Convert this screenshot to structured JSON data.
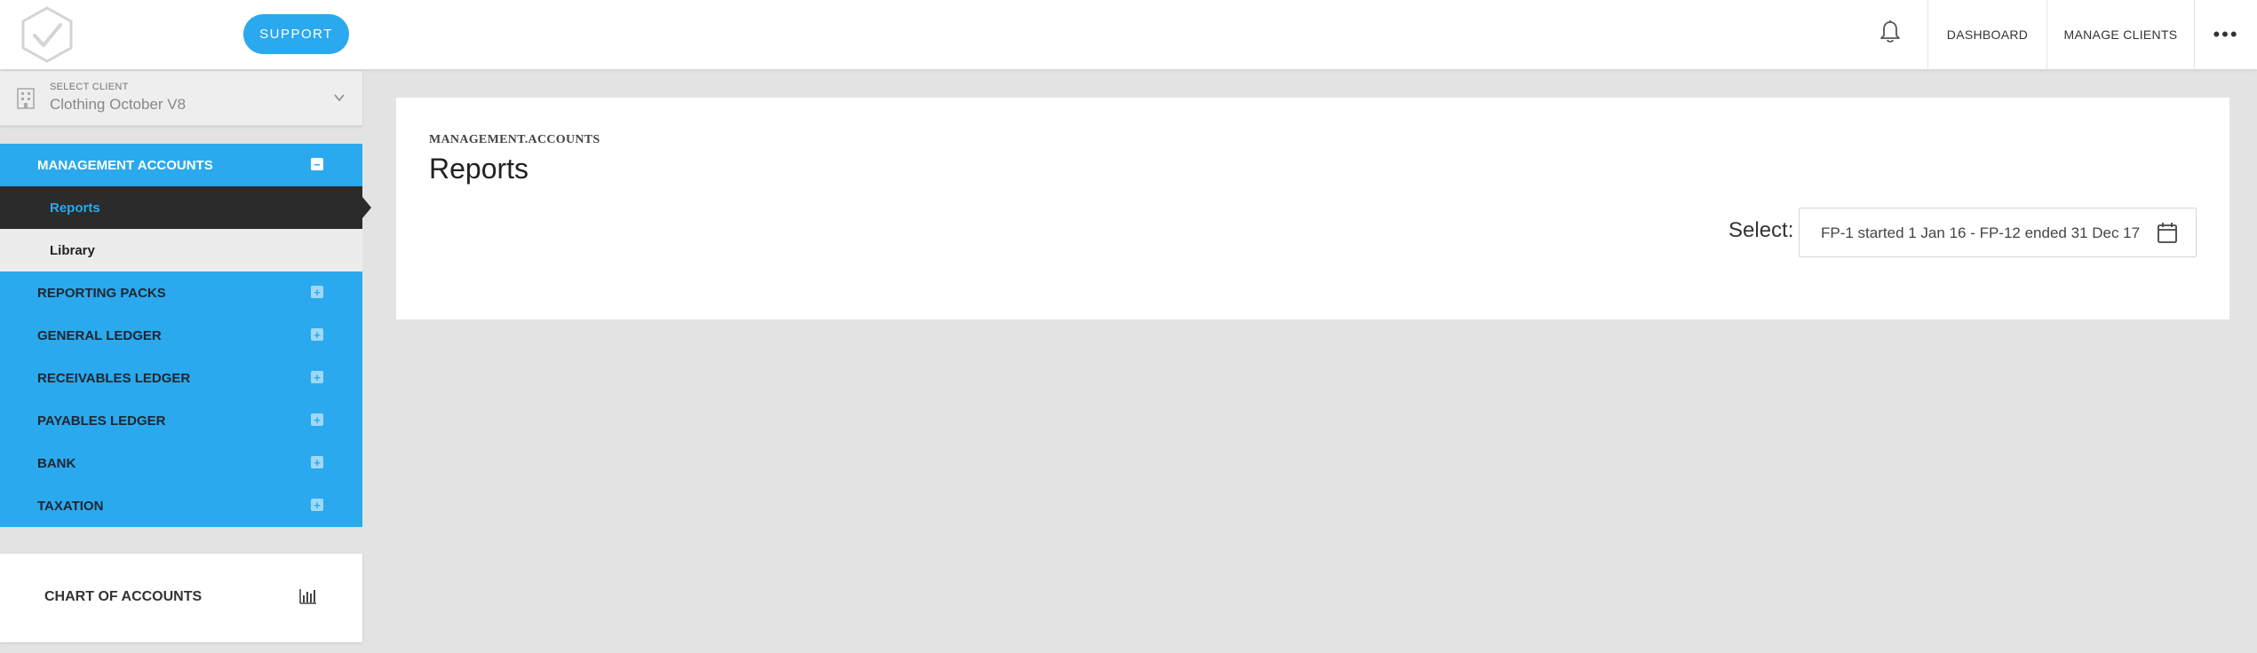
{
  "header": {
    "support_label": "SUPPORT",
    "dashboard_label": "DASHBOARD",
    "manage_clients_label": "MANAGE CLIENTS",
    "more_label": "•••",
    "icons": [
      "logo-icon",
      "bell-icon",
      "more-icon"
    ]
  },
  "client_select": {
    "label": "SELECT CLIENT",
    "value": "Clothing October V8"
  },
  "sidebar": {
    "groups": [
      {
        "label": "MANAGEMENT ACCOUNTS",
        "toggle": "−",
        "expanded": true
      },
      {
        "label": "REPORTING PACKS",
        "toggle": "+"
      },
      {
        "label": "GENERAL LEDGER",
        "toggle": "+"
      },
      {
        "label": "RECEIVABLES LEDGER",
        "toggle": "+"
      },
      {
        "label": "PAYABLES LEDGER",
        "toggle": "+"
      },
      {
        "label": "BANK",
        "toggle": "+"
      },
      {
        "label": "TAXATION",
        "toggle": "+"
      }
    ],
    "sub_items": [
      {
        "label": "Reports",
        "selected": true
      },
      {
        "label": "Library",
        "selected": false
      }
    ],
    "chart_of_accounts": "CHART OF ACCOUNTS"
  },
  "main": {
    "breadcrumb": "MANAGEMENT.ACCOUNTS",
    "title": "Reports",
    "select_label": "Select:",
    "period_value": "FP-1 started 1 Jan 16 - FP-12 ended 31 Dec 17"
  },
  "colors": {
    "accent": "#2aa9ee",
    "selected_bg": "#2b2b2b",
    "page_bg": "#e3e3e3"
  }
}
